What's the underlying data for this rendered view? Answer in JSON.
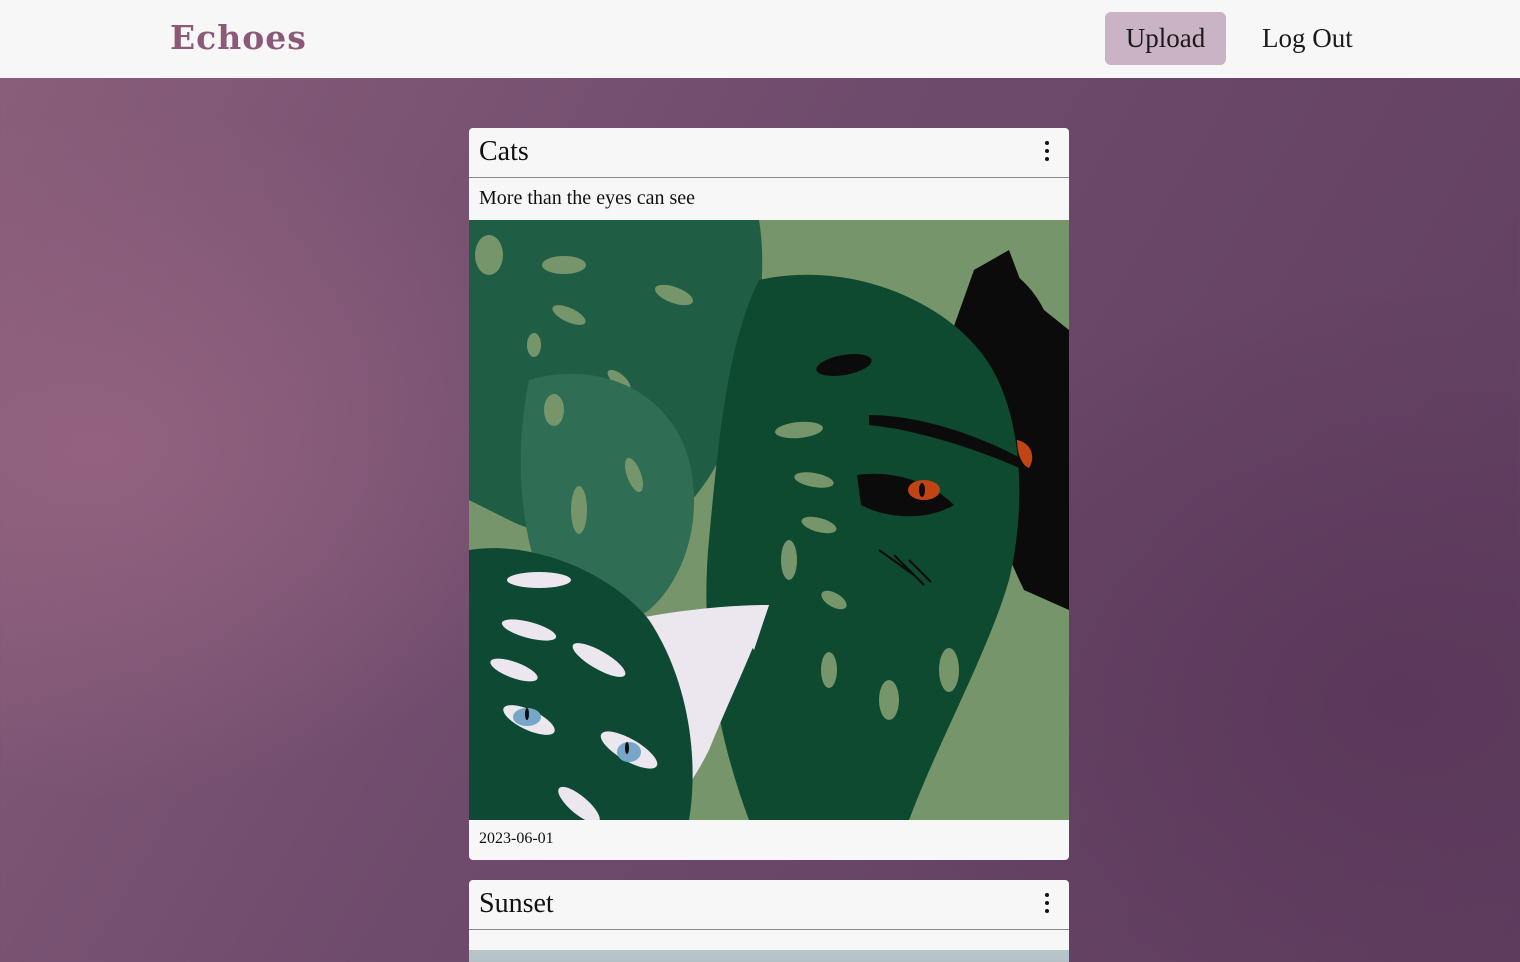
{
  "header": {
    "brand": "Echoes",
    "upload_label": "Upload",
    "logout_label": "Log Out"
  },
  "posts": [
    {
      "title": "Cats",
      "description": "More than the eyes can see",
      "date": "2023-06-01",
      "menu_icon": "more-vertical-icon"
    },
    {
      "title": "Sunset",
      "description": "",
      "menu_icon": "more-vertical-icon"
    }
  ],
  "colors": {
    "brand": "#8c5a78",
    "upload_button_bg": "#c9b3c4",
    "navbar_bg": "#f7f7f7",
    "background": "#6e4a6c"
  }
}
